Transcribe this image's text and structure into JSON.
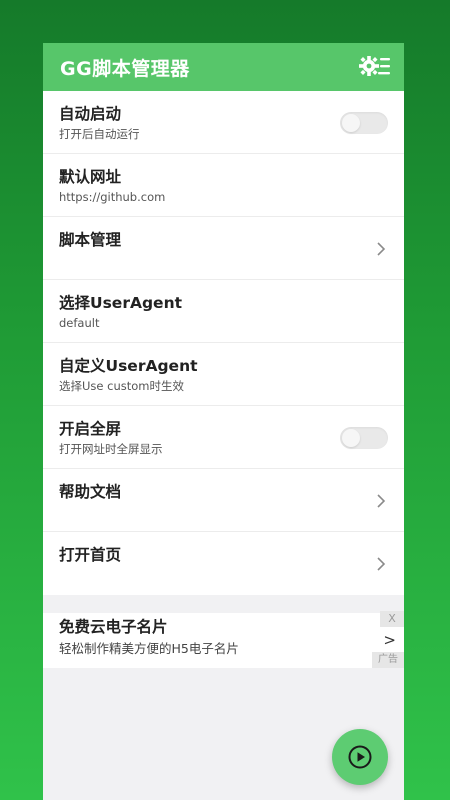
{
  "app": {
    "title": "GG脚本管理器"
  },
  "colors": {
    "appbar": "#57c66a",
    "background_top": "#157a2a",
    "background_bottom": "#30c24a",
    "fab": "#5dcc72"
  },
  "settings": [
    {
      "title": "自动启动",
      "subtitle": "打开后自动运行",
      "control": "toggle",
      "checked": false
    },
    {
      "title": "默认网址",
      "subtitle": "https://github.com",
      "control": "none"
    },
    {
      "title": "脚本管理",
      "subtitle": "",
      "control": "chevron"
    },
    {
      "title": "选择UserAgent",
      "subtitle": "default",
      "control": "none"
    },
    {
      "title": "自定义UserAgent",
      "subtitle": "选择Use custom时生效",
      "control": "none"
    },
    {
      "title": "开启全屏",
      "subtitle": "打开网址时全屏显示",
      "control": "toggle",
      "checked": false
    },
    {
      "title": "帮助文档",
      "subtitle": "",
      "control": "chevron"
    },
    {
      "title": "打开首页",
      "subtitle": "",
      "control": "chevron"
    }
  ],
  "ad": {
    "title": "免费云电子名片",
    "description": "轻松制作精美方便的H5电子名片",
    "close_label": "X",
    "arrow": ">",
    "label": "广告"
  },
  "icons": {
    "appbar_action": "settings-list-icon",
    "fab": "play-circle-icon",
    "row_arrow": "chevron-right-icon"
  }
}
